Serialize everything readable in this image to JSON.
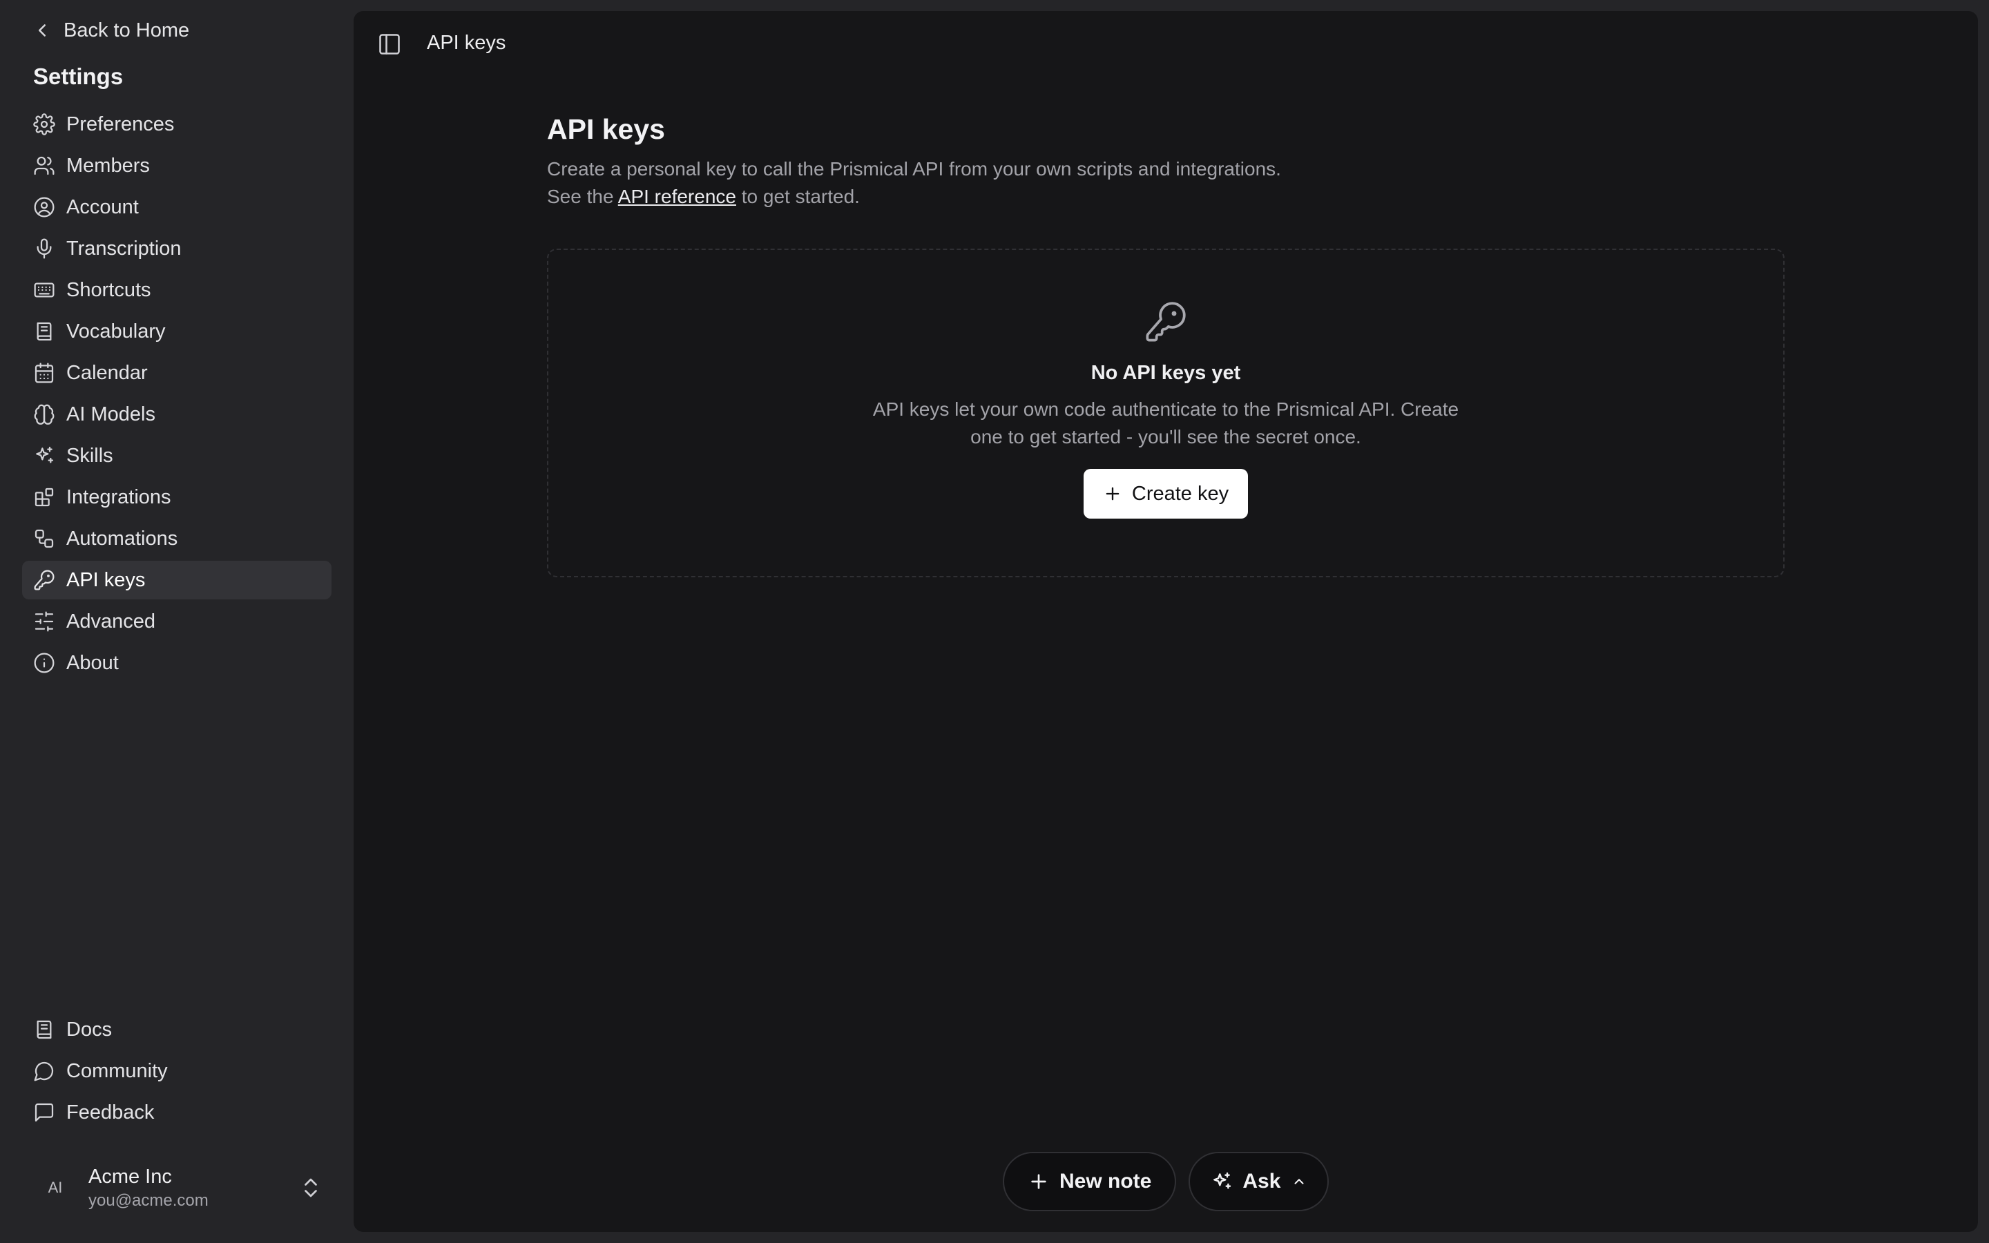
{
  "sidebar": {
    "back_label": "Back to Home",
    "title": "Settings",
    "items": [
      {
        "label": "Preferences",
        "icon": "gear-icon"
      },
      {
        "label": "Members",
        "icon": "users-icon"
      },
      {
        "label": "Account",
        "icon": "user-circle-icon"
      },
      {
        "label": "Transcription",
        "icon": "microphone-icon"
      },
      {
        "label": "Shortcuts",
        "icon": "keyboard-icon"
      },
      {
        "label": "Vocabulary",
        "icon": "book-icon"
      },
      {
        "label": "Calendar",
        "icon": "calendar-icon"
      },
      {
        "label": "AI Models",
        "icon": "brain-icon"
      },
      {
        "label": "Skills",
        "icon": "sparkles-icon"
      },
      {
        "label": "Integrations",
        "icon": "blocks-icon"
      },
      {
        "label": "Automations",
        "icon": "workflow-icon"
      },
      {
        "label": "API keys",
        "icon": "key-icon",
        "active": true
      },
      {
        "label": "Advanced",
        "icon": "sliders-icon"
      },
      {
        "label": "About",
        "icon": "info-icon"
      }
    ],
    "bottom_items": [
      {
        "label": "Docs",
        "icon": "book-icon"
      },
      {
        "label": "Community",
        "icon": "chat-bubble-icon"
      },
      {
        "label": "Feedback",
        "icon": "message-square-icon"
      }
    ],
    "account": {
      "initials": "AI",
      "name": "Acme Inc",
      "email": "you@acme.com"
    }
  },
  "topbar": {
    "title": "API keys"
  },
  "page": {
    "title": "API keys",
    "desc_line1": "Create a personal key to call the Prismical API from your own scripts and integrations.",
    "desc_prefix": "See the ",
    "desc_link": "API reference",
    "desc_suffix": " to get started."
  },
  "empty_state": {
    "title": "No API keys yet",
    "desc": "API keys let your own code authenticate to the Prismical API. Create one to get started - you'll see the secret once.",
    "button_label": "Create key"
  },
  "floating": {
    "new_note_label": "New note",
    "ask_label": "Ask"
  },
  "colors": {
    "sidebar_bg": "#252528",
    "main_bg": "#161618",
    "active_item_bg": "#333337",
    "button_bg": "#ffffff"
  }
}
